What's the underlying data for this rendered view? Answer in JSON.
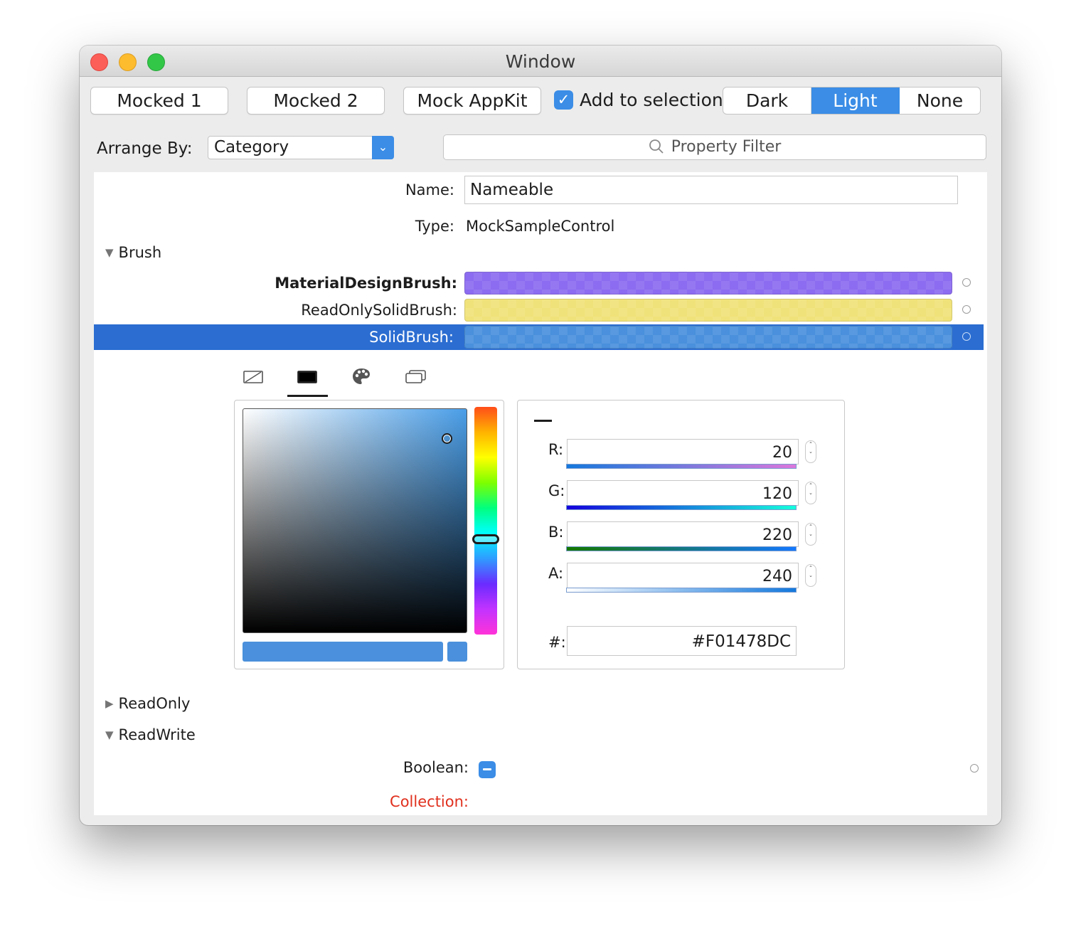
{
  "window": {
    "title": "Window"
  },
  "toolbar": {
    "mocked1": "Mocked 1",
    "mocked2": "Mocked 2",
    "mock_appkit": "Mock AppKit",
    "add_to_selection": {
      "label": "Add to selection",
      "checked": true
    },
    "theme": {
      "options": [
        "Dark",
        "Light",
        "None"
      ],
      "selected": "Light"
    }
  },
  "arrange": {
    "label": "Arrange By:",
    "value": "Category"
  },
  "filter": {
    "placeholder": "Property Filter"
  },
  "properties": {
    "name_label": "Name:",
    "name_value": "Nameable",
    "type_label": "Type:",
    "type_value": "MockSampleControl",
    "groups": {
      "brush": "Brush",
      "readonly": "ReadOnly",
      "readwrite": "ReadWrite"
    },
    "brush_items": [
      {
        "label": "MaterialDesignBrush:",
        "color": "#8c6cf0"
      },
      {
        "label": "ReadOnlySolidBrush:",
        "color": "#f0e27a"
      },
      {
        "label": "SolidBrush:",
        "color": "#4a90dc"
      }
    ],
    "boolean_label": "Boolean:",
    "collection_label": "Collection:"
  },
  "color_editor": {
    "tabs": [
      "no-brush-icon",
      "solid-color-icon",
      "palette-icon",
      "resource-icon"
    ],
    "active_tab": "solid-color-icon",
    "channels": [
      {
        "label": "R:",
        "value": "20"
      },
      {
        "label": "G:",
        "value": "120"
      },
      {
        "label": "B:",
        "value": "220"
      },
      {
        "label": "A:",
        "value": "240"
      }
    ],
    "hex_label": "#:",
    "hex_value": "#F01478DC"
  },
  "colors": {
    "accent": "#3b8de6",
    "selection": "#2b6dd1",
    "error_label": "#e0301e",
    "brush_preview": "#4a90dc"
  }
}
